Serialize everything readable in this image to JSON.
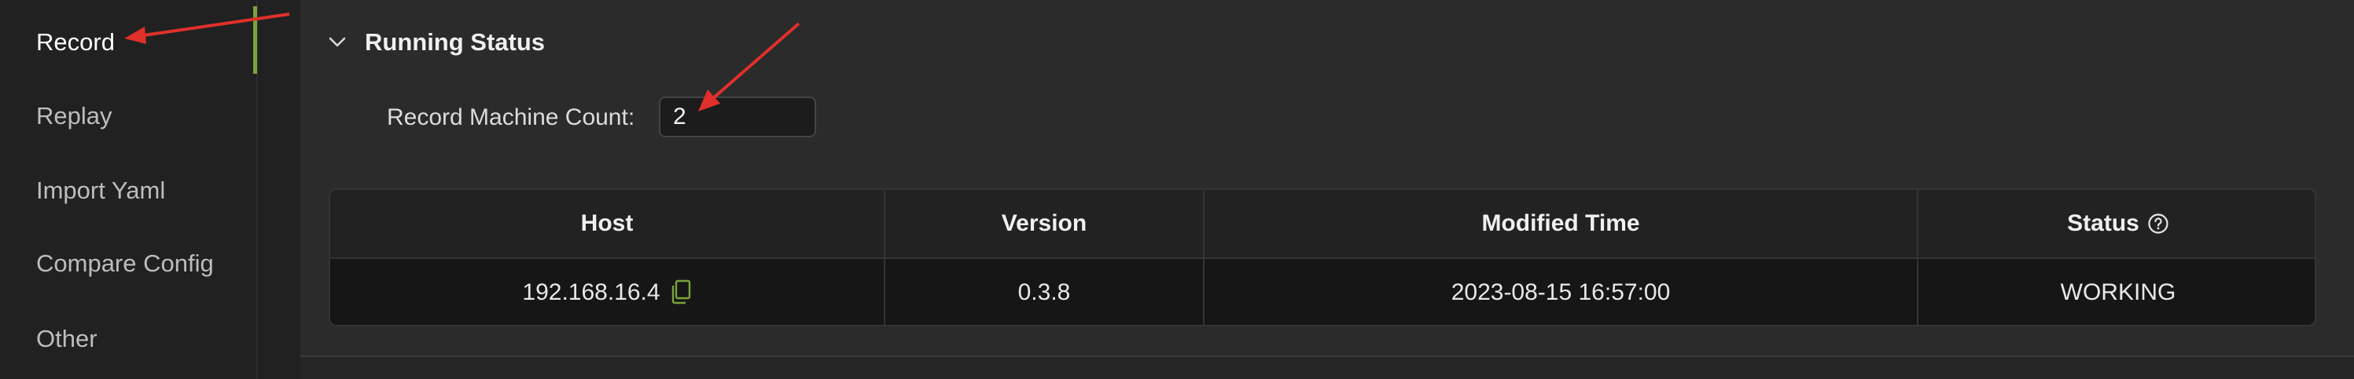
{
  "sidebar": {
    "items": [
      {
        "label": "Record"
      },
      {
        "label": "Replay"
      },
      {
        "label": "Import Yaml"
      },
      {
        "label": "Compare Config"
      },
      {
        "label": "Other"
      }
    ]
  },
  "panel": {
    "title": "Running Status",
    "record_machine_count_label": "Record Machine Count:",
    "record_machine_count_value": "2"
  },
  "table": {
    "headers": [
      "Host",
      "Version",
      "Modified Time",
      "Status"
    ],
    "rows": [
      {
        "host": "192.168.16.4",
        "version": "0.3.8",
        "modified_time": "2023-08-15 16:57:00",
        "status": "WORKING"
      }
    ]
  },
  "colors": {
    "accent": "#7aa33a",
    "arrow": "#e0302b",
    "background": "#212121",
    "panel": "#2b2b2b"
  }
}
